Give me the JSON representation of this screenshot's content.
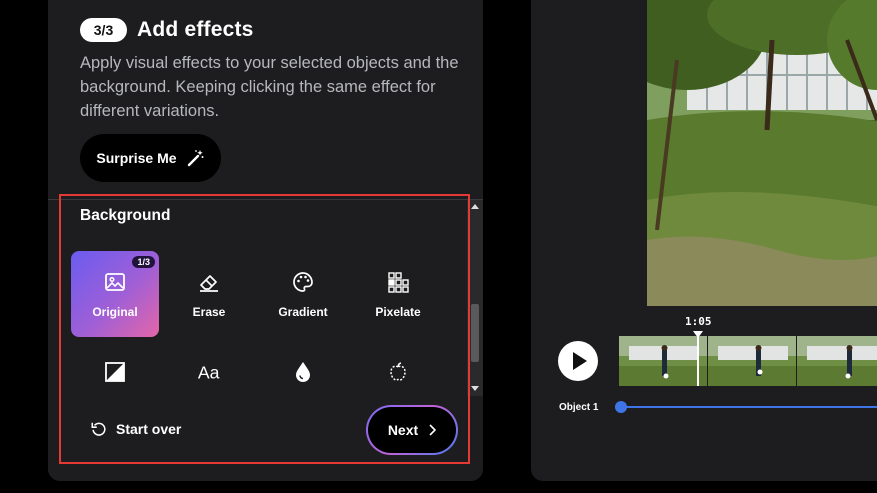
{
  "step": {
    "badge": "3/3",
    "title": "Add effects",
    "description": "Apply visual effects to your selected objects and the background. Keeping clicking the same effect for different variations."
  },
  "surprise": {
    "label": "Surprise Me",
    "icon": "magic-wand-icon"
  },
  "section": {
    "title": "Background"
  },
  "effects": [
    {
      "label": "Original",
      "icon": "image-icon",
      "selected": true,
      "count": "1/3"
    },
    {
      "label": "Erase",
      "icon": "eraser-icon"
    },
    {
      "label": "Gradient",
      "icon": "palette-icon"
    },
    {
      "label": "Pixelate",
      "icon": "pixel-grid-icon"
    },
    {
      "label": "",
      "icon": "contrast-icon"
    },
    {
      "label": "",
      "icon": "text-aa-icon"
    },
    {
      "label": "",
      "icon": "droplet-icon"
    },
    {
      "label": "",
      "icon": "apple-outline-icon"
    }
  ],
  "footer": {
    "start_over": "Start over",
    "next": "Next"
  },
  "player": {
    "timecode": "1:05",
    "object_label": "Object 1"
  },
  "colors": {
    "accent": "#3f74e6",
    "highlight": "#e53935",
    "panel": "#1d1d1f"
  }
}
